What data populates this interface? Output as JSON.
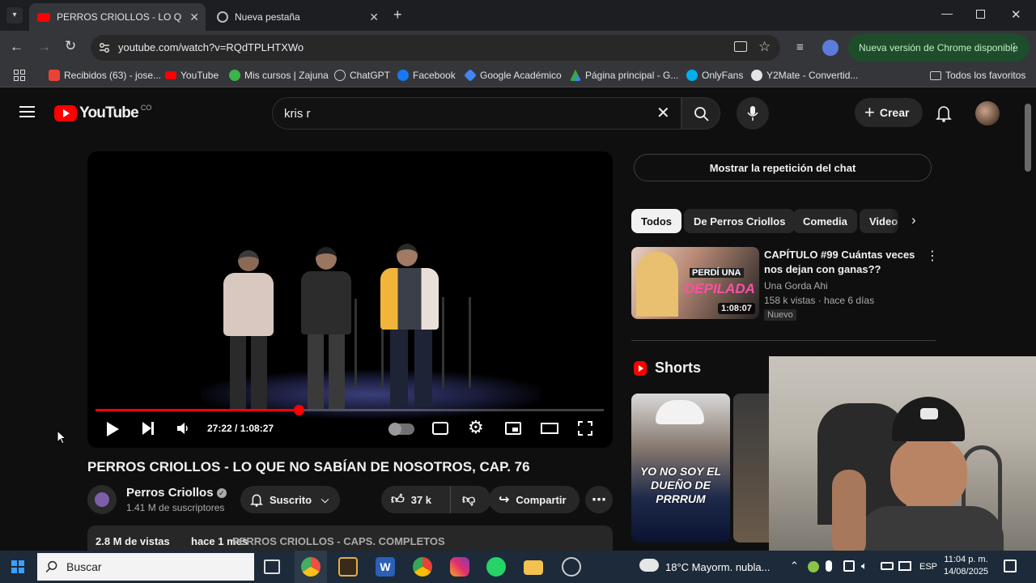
{
  "browser": {
    "tabs": [
      {
        "label": "PERROS CRIOLLOS - LO QUE N",
        "active": true
      },
      {
        "label": "Nueva pestaña",
        "active": false
      }
    ],
    "url": "youtube.com/watch?v=RQdTPLHTXWo",
    "update_label": "Nueva versión de Chrome disponible",
    "bookmarks": [
      {
        "label": "Recibidos (63) - jose...",
        "icon": "gmail-icon",
        "color": "#ea4335"
      },
      {
        "label": "YouTube",
        "icon": "youtube-icon",
        "color": "#ff0000"
      },
      {
        "label": "Mis cursos | Zajuna",
        "icon": "zajuna-icon",
        "color": "#39b54a"
      },
      {
        "label": "ChatGPT",
        "icon": "chatgpt-icon",
        "color": "#cccccc"
      },
      {
        "label": "Facebook",
        "icon": "facebook-icon",
        "color": "#1877f2"
      },
      {
        "label": "Google Académico",
        "icon": "scholar-icon",
        "color": "#4285f4"
      },
      {
        "label": "Página principal - G...",
        "icon": "drive-icon",
        "color": "#fbbc04"
      },
      {
        "label": "OnlyFans",
        "icon": "onlyfans-icon",
        "color": "#00aff0"
      },
      {
        "label": "Y2Mate - Convertid...",
        "icon": "y2mate-icon",
        "color": "#e5e5e5"
      }
    ],
    "all_bookmarks_label": "Todos los favoritos"
  },
  "youtube": {
    "logo_text": "YouTube",
    "country_code": "CO",
    "search_value": "kris r",
    "create_label": "Crear"
  },
  "player": {
    "time": "27:22 / 1:08:27",
    "progress": 0.4
  },
  "video": {
    "title": "PERROS CRIOLLOS - LO QUE NO SABÍAN DE NOSOTROS, CAP. 76",
    "channel": "Perros Criollos",
    "subscribers": "1.41 M de suscriptores",
    "subscribed_label": "Suscrito",
    "likes": "37 k",
    "share_label": "Compartir",
    "views": "2.8 M de vistas",
    "published": "hace 1 mes",
    "playlist": "PERROS CRIOLLOS - CAPS. COMPLETOS"
  },
  "sidebar": {
    "chat_replay_label": "Mostrar la repetición del chat",
    "chips": [
      "Todos",
      "De Perros Criollos",
      "Comedia",
      "Video"
    ],
    "recommendation": {
      "title": "CAPÍTULO #99 Cuántas veces nos dejan con ganas??",
      "channel": "Una Gorda Ahi",
      "meta": "158 k vistas · hace 6 días",
      "badge": "Nuevo",
      "duration": "1:08:07",
      "thumb_text_1": "PERDÍ UNA",
      "thumb_text_2": "DEPILADA"
    },
    "shorts_label": "Shorts",
    "short_caption": "YO NO SOY EL DUEÑO DE PRRRUM"
  },
  "taskbar": {
    "search_label": "Buscar",
    "weather": "18°C  Mayorm. nubla...",
    "language": "ESP",
    "time": "11:04 p. m.",
    "date": "14/08/2025"
  }
}
